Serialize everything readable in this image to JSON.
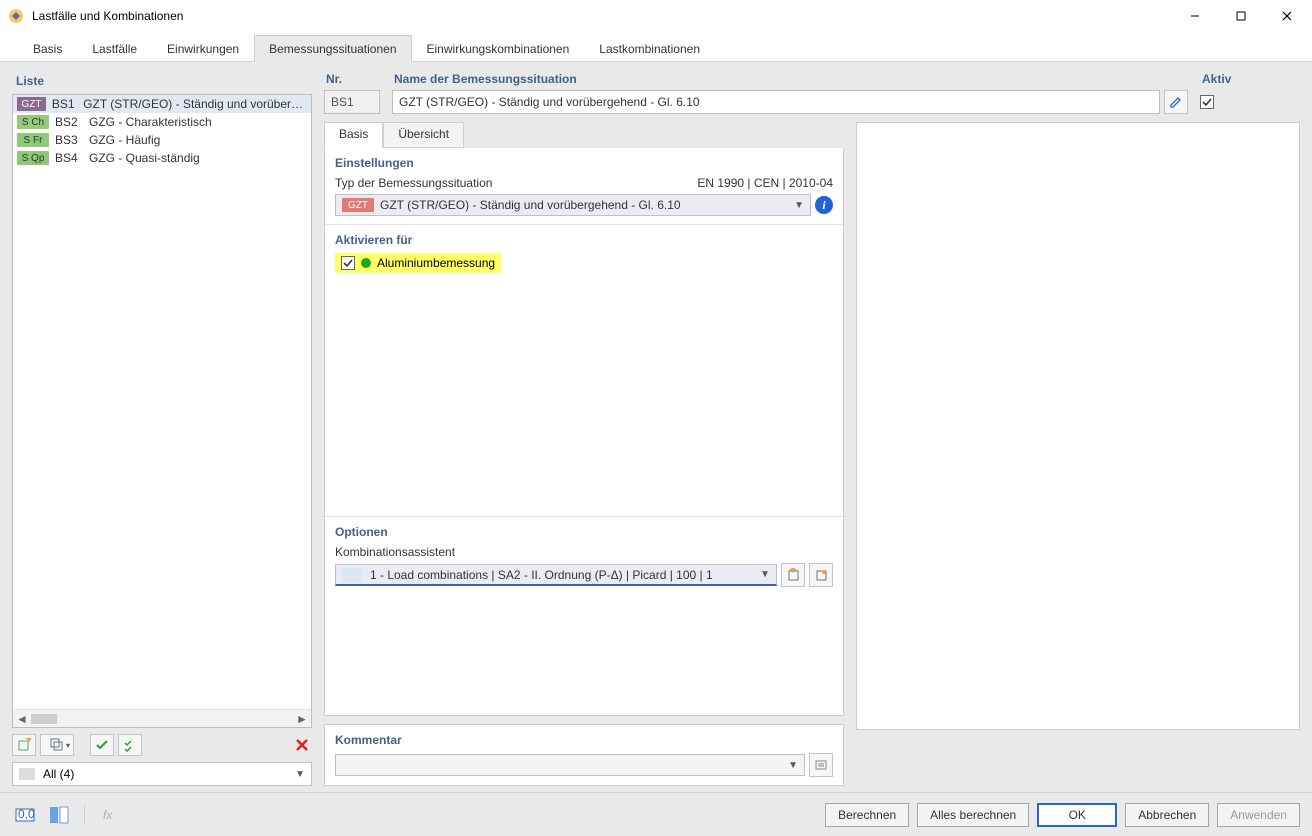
{
  "window": {
    "title": "Lastfälle und Kombinationen"
  },
  "tabs": {
    "items": [
      "Basis",
      "Lastfälle",
      "Einwirkungen",
      "Bemessungssituationen",
      "Einwirkungskombinationen",
      "Lastkombinationen"
    ],
    "active_index": 3
  },
  "list": {
    "title": "Liste",
    "rows": [
      {
        "badge": "GZT",
        "badge_class": "gzt",
        "code": "BS1",
        "name": "GZT (STR/GEO) - Ständig und vorübergehend",
        "selected": true
      },
      {
        "badge": "S Ch",
        "badge_class": "sch",
        "code": "BS2",
        "name": "GZG - Charakteristisch",
        "selected": false
      },
      {
        "badge": "S Fr",
        "badge_class": "sfr",
        "code": "BS3",
        "name": "GZG - Häufig",
        "selected": false
      },
      {
        "badge": "S Qp",
        "badge_class": "sqp",
        "code": "BS4",
        "name": "GZG - Quasi-ständig",
        "selected": false
      }
    ],
    "filter": "All (4)"
  },
  "detail": {
    "nr_label": "Nr.",
    "nr_value": "BS1",
    "name_label": "Name der Bemessungssituation",
    "name_value": "GZT (STR/GEO) - Ständig und vorübergehend - Gl. 6.10",
    "aktiv_label": "Aktiv",
    "aktiv_checked": true
  },
  "inner_tabs": {
    "items": [
      "Basis",
      "Übersicht"
    ],
    "active_index": 0
  },
  "einstellungen": {
    "title": "Einstellungen",
    "type_label": "Typ der Bemessungssituation",
    "norm_ref": "EN 1990 | CEN | 2010-04",
    "type_badge": "GZT",
    "type_value": "GZT (STR/GEO) - Ständig und vorübergehend - Gl. 6.10"
  },
  "aktivieren": {
    "title": "Aktivieren für",
    "items": [
      {
        "label": "Aluminiumbemessung",
        "checked": true
      }
    ]
  },
  "optionen": {
    "title": "Optionen",
    "assistant_label": "Kombinationsassistent",
    "assistant_value": "1 - Load combinations | SA2 - II. Ordnung (P-Δ) | Picard | 100 | 1"
  },
  "kommentar": {
    "title": "Kommentar"
  },
  "buttons": {
    "berechnen": "Berechnen",
    "alles_berechnen": "Alles berechnen",
    "ok": "OK",
    "abbrechen": "Abbrechen",
    "anwenden": "Anwenden"
  }
}
